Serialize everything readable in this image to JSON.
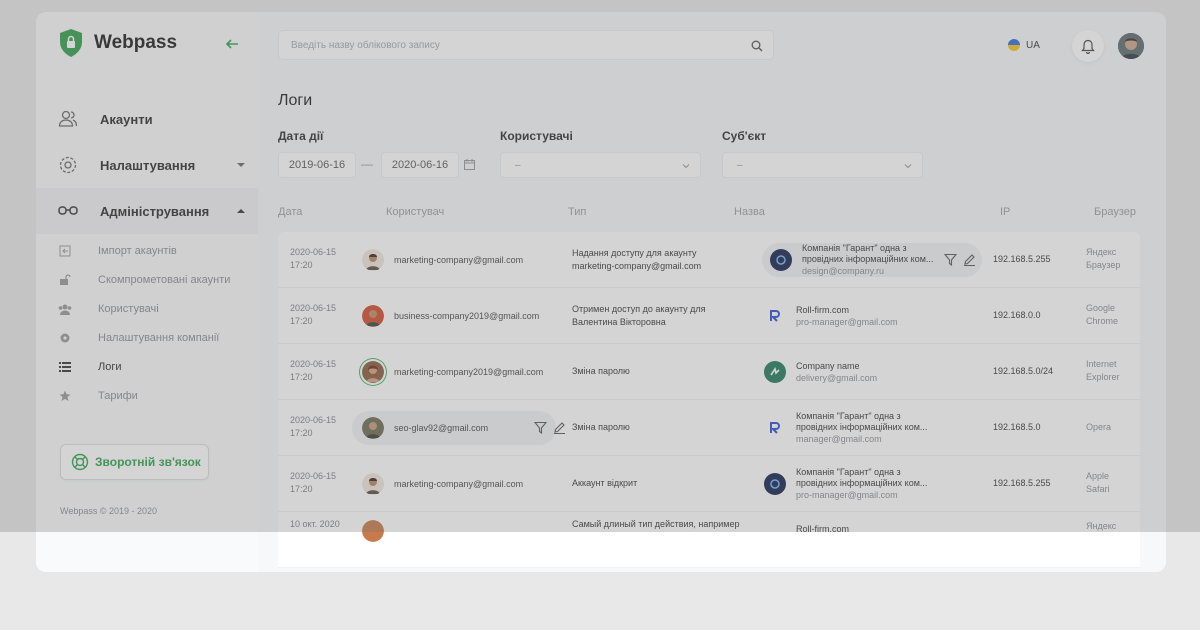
{
  "brand": {
    "name": "Webpass"
  },
  "sidebar": {
    "main": [
      {
        "label": "Акаунти",
        "icon": "users-icon"
      },
      {
        "label": "Налаштування",
        "icon": "gear-icon"
      },
      {
        "label": "Адміністрування",
        "icon": "glasses-icon"
      }
    ],
    "sub": [
      {
        "label": "Імпорт акаунтів",
        "icon": "import-icon"
      },
      {
        "label": "Скомпрометовані акаунти",
        "icon": "unlock-icon"
      },
      {
        "label": "Користувачі",
        "icon": "group-icon"
      },
      {
        "label": "Налаштування компанії",
        "icon": "cog-icon"
      },
      {
        "label": "Логи",
        "icon": "list-icon"
      },
      {
        "label": "Тарифи",
        "icon": "star-icon"
      }
    ],
    "feedback_label": "Зворотній зв'язок",
    "copyright": "Webpass © 2019 - 2020"
  },
  "topbar": {
    "search_placeholder": "Введіть назву облікового запису",
    "lang": "UA"
  },
  "page": {
    "title": "Логи"
  },
  "filters": {
    "date_label": "Дата дії",
    "date_from": "2019-06-16",
    "date_dash": "—",
    "date_to": "2020-06-16",
    "users_label": "Користувачі",
    "users_value": "–",
    "subject_label": "Суб'єкт",
    "subject_value": "–"
  },
  "table": {
    "headers": [
      "Дата",
      "Користувач",
      "Тип",
      "Назва",
      "IP",
      "Браузер"
    ],
    "rows": [
      {
        "date": "2020-06-15",
        "time": "17:20",
        "user": "marketing-company@gmail.com",
        "type1": "Надання доступу для акаунту",
        "type2": "marketing-company@gmail.com",
        "subj_name1": "Компанія \"Гарант\" одна з",
        "subj_name2": "провідних інформаційних ком...",
        "subj_email": "design@company.ru",
        "ip": "192.168.5.255",
        "br1": "Яндекс",
        "br2": "Браузер"
      },
      {
        "date": "2020-06-15",
        "time": "17:20",
        "user": "business-company2019@gmail.com",
        "type1": "Отримен доступ до акаунту для",
        "type2": "Валентина Вікторовна",
        "subj_name1": "Roll-firm.com",
        "subj_name2": "",
        "subj_email": "pro-manager@gmail.com",
        "ip": "192.168.0.0",
        "br1": "Google",
        "br2": "Chrome"
      },
      {
        "date": "2020-06-15",
        "time": "17:20",
        "user": "marketing-company2019@gmail.com",
        "type1": "Зміна паролю",
        "type2": "",
        "subj_name1": "Company name",
        "subj_name2": "",
        "subj_email": "delivery@gmail.com",
        "ip": "192.168.5.0/24",
        "br1": "Internet",
        "br2": "Explorer"
      },
      {
        "date": "2020-06-15",
        "time": "17:20",
        "user": "seo-glav92@gmail.com",
        "type1": "Зміна паролю",
        "type2": "",
        "subj_name1": "Компанія \"Гарант\" одна з",
        "subj_name2": "провідних інформаційних ком...",
        "subj_email": "manager@gmail.com",
        "ip": "192.168.5.0",
        "br1": "Opera",
        "br2": ""
      },
      {
        "date": "2020-06-15",
        "time": "17:20",
        "user": "marketing-company@gmail.com",
        "type1": "Аккаунт відкрит",
        "type2": "",
        "subj_name1": "Компанія \"Гарант\" одна з",
        "subj_name2": "провідних інформаційних ком...",
        "subj_email": "pro-manager@gmail.com",
        "ip": "192.168.5.255",
        "br1": "Apple",
        "br2": "Safari"
      },
      {
        "date": "10 окт. 2020",
        "time": "",
        "user": "",
        "type1": "Самый длиный тип действия, например",
        "type2": "",
        "subj_name1": "Roll-firm.com",
        "subj_name2": "",
        "subj_email": "",
        "ip": "",
        "br1": "Яндекс",
        "br2": ""
      }
    ]
  },
  "colors": {
    "accent": "#2aa34a",
    "brand_shield": "#2f9e49"
  }
}
